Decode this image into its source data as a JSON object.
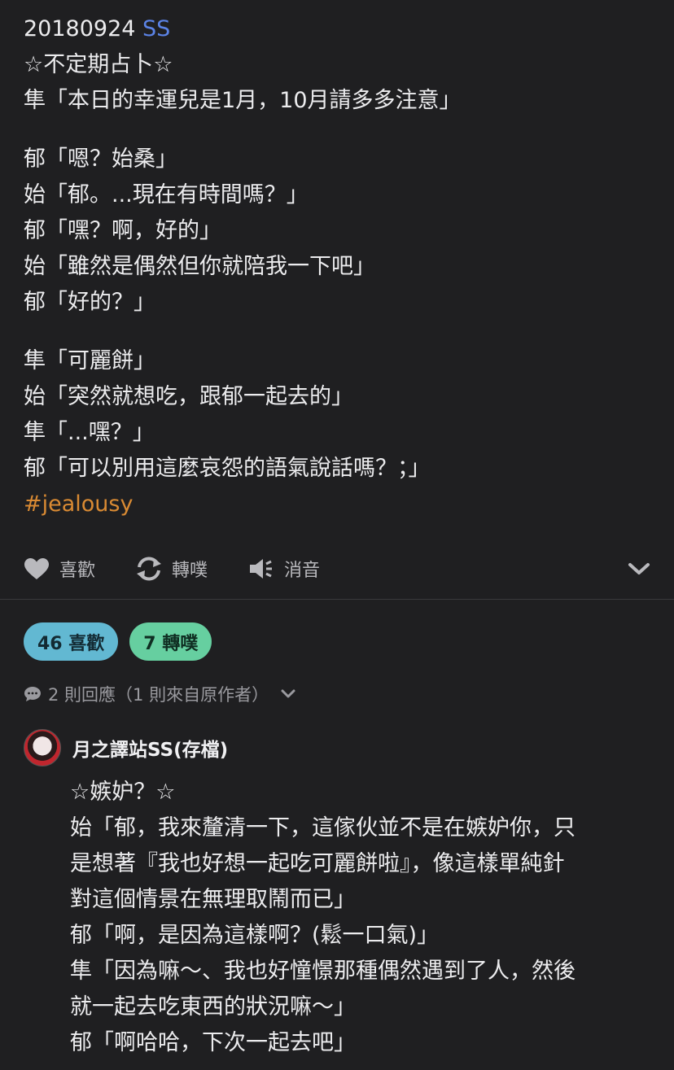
{
  "post": {
    "date": "20180924",
    "date_tag": "SS",
    "lines_group1": [
      "☆不定期占卜☆",
      "隼「本日的幸運兒是1月，10月請多多注意」"
    ],
    "lines_group2": [
      "郁「嗯？始桑」",
      "始「郁。...現在有時間嗎？」",
      "郁「嘿？啊，好的」",
      "始「雖然是偶然但你就陪我一下吧」",
      "郁「好的？」"
    ],
    "lines_group3": [
      "隼「可麗餅」",
      "始「突然就想吃，跟郁一起去的」",
      "隼「...嘿？」",
      "郁「可以別用這麼哀怨的語氣說話嗎？；」"
    ],
    "hashtag": "#jealousy"
  },
  "actions": {
    "like": "喜歡",
    "replurk": "轉噗",
    "mute": "消音"
  },
  "stats": {
    "likes": "46 喜歡",
    "replurks": "7 轉噗"
  },
  "responses": {
    "summary": "2 則回應（1 則來自原作者）"
  },
  "reply": {
    "author": "月之譯站SS(存檔)",
    "lines": [
      "☆嫉妒？☆",
      "始「郁，我來釐清一下，這傢伙並不是在嫉妒你，只",
      "是想著『我也好想一起吃可麗餅啦』，像這樣單純針",
      "對這個情景在無理取鬧而已」",
      "郁「啊，是因為這樣啊？(鬆一口氣)」",
      "隼「因為嘛～、我也好憧憬那種偶然遇到了人，然後",
      "就一起去吃東西的狀況嘛～」",
      "郁「啊哈哈，下次一起去吧」"
    ]
  },
  "colors": {
    "background": "#1f1f21",
    "accent_blue": "#5b83e6",
    "hashtag": "#d98a33",
    "like_pill": "#62b8d2",
    "replurk_pill": "#66cfa0"
  }
}
